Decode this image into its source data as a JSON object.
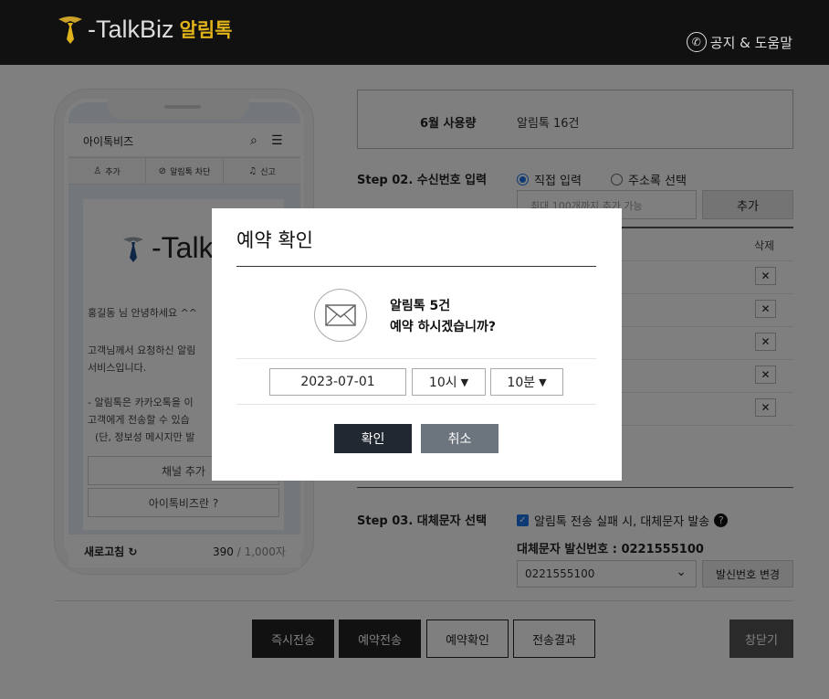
{
  "header": {
    "brand": "-TalkBiz",
    "brand_ko": "알림톡",
    "help_label": "공지 & 도움말"
  },
  "phone": {
    "title": "아이톡비즈",
    "tabs": [
      "추가",
      "알림톡 차단",
      "신고"
    ],
    "card_logo": "-Talk",
    "greeting": "홍길동 님 안녕하세요 ^^",
    "body_line1": "고객님께서 요청하신 알림",
    "body_line2": "서비스입니다.",
    "body_line3": "- 알림톡은 카카오톡을 이",
    "body_line4": "고객에게 전송할 수 있습",
    "body_line5": "(단, 정보성 메시지만 발",
    "btn_channel": "채널 추가",
    "btn_about": "아이톡비즈란 ?",
    "refresh_label": "새로고침",
    "count_current": "390",
    "count_max": " / 1,000자"
  },
  "usage": {
    "label": "6월 사용량",
    "value": "알림톡 16건"
  },
  "step2": {
    "title": "Step 02. 수신번호 입력",
    "radio_direct": "직접 입력",
    "radio_address": "주소록 선택",
    "input_placeholder": "최대 100개까지 추가 가능",
    "add_label": "추가",
    "delete_header": "삭제",
    "delete_symbol": "✕"
  },
  "step3": {
    "title": "Step 03. 대체문자 선택",
    "fallback_label": "알림톡 전송 실패 시, 대체문자 발송",
    "sender_label": "대체문자 발신번호 : 0221555100",
    "sender_value": "0221555100",
    "change_label": "발신번호 변경"
  },
  "bottom": {
    "instant": "즉시전송",
    "reserve": "예약전송",
    "reserve_check": "예약확인",
    "result": "전송결과",
    "close": "창닫기"
  },
  "modal": {
    "title": "예약 확인",
    "msg_line1": "알림톡 5건",
    "msg_line2": "예약 하시겠습니까?",
    "date": "2023-07-01",
    "hour": "10시",
    "minute": "10분",
    "confirm": "확인",
    "cancel": "취소"
  },
  "colors": {
    "header_bg": "#111111",
    "brand_accent": "#e0b31a",
    "confirm_bg": "#222831",
    "cancel_bg": "#6c757d"
  }
}
